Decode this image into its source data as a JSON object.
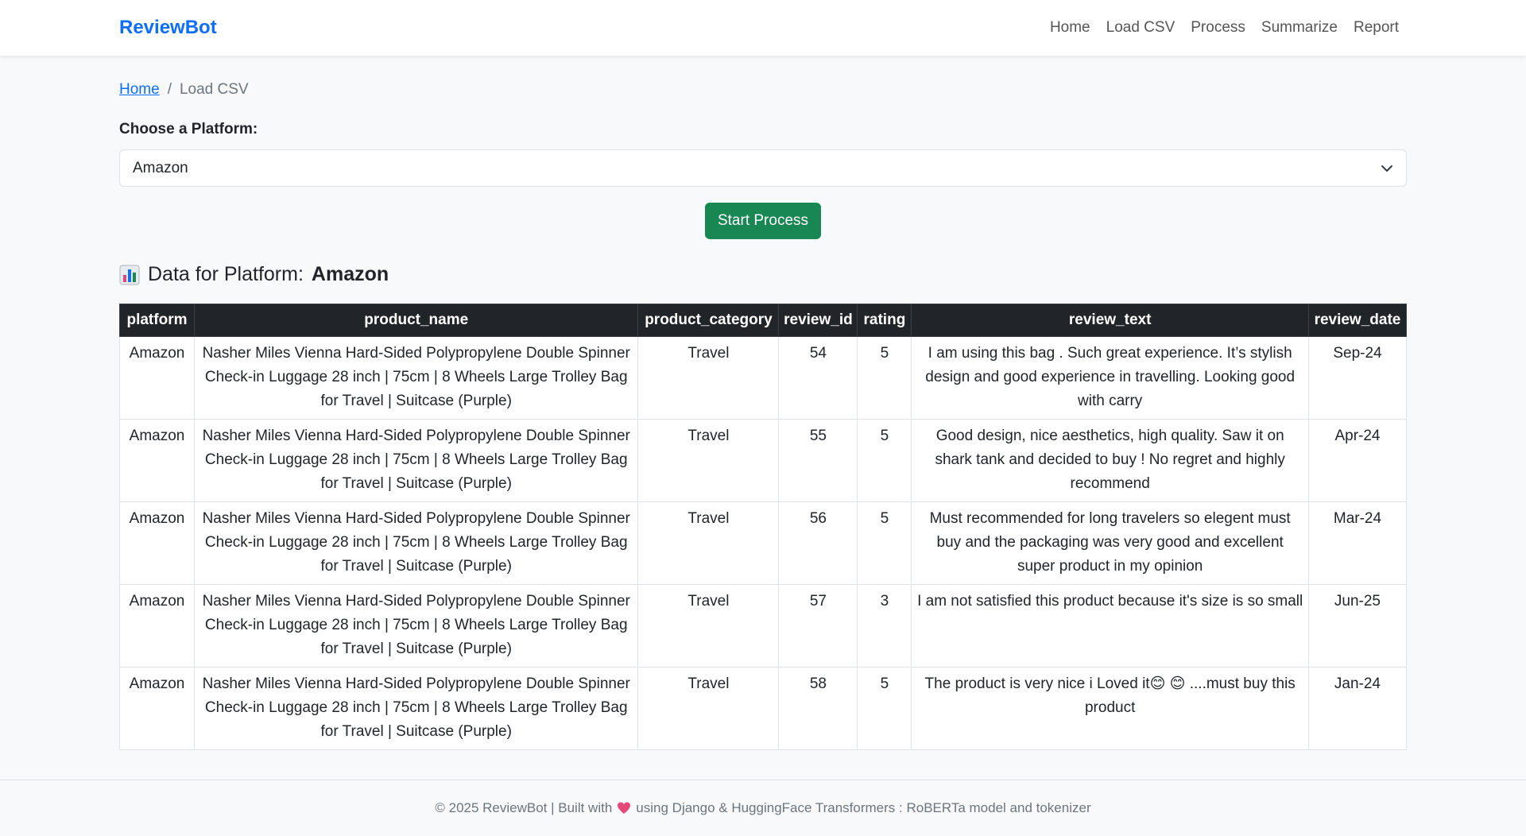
{
  "navbar": {
    "brand": "ReviewBot",
    "links": [
      "Home",
      "Load CSV",
      "Process",
      "Summarize",
      "Report"
    ]
  },
  "breadcrumb": {
    "home": "Home",
    "separator": "/",
    "current": "Load CSV"
  },
  "form": {
    "label": "Choose a Platform:",
    "selected_platform": "Amazon",
    "start_button": "Start Process"
  },
  "data_section": {
    "heading_prefix": "Data for Platform:",
    "platform": "Amazon",
    "columns": [
      "platform",
      "product_name",
      "product_category",
      "review_id",
      "rating",
      "review_text",
      "review_date"
    ],
    "rows": [
      [
        "Amazon",
        "Nasher Miles Vienna Hard-Sided Polypropylene Double Spinner Check-in Luggage 28 inch | 75cm | 8 Wheels Large Trolley Bag for Travel | Suitcase (Purple)",
        "Travel",
        "54",
        "5",
        "I am using this bag . Such great experience. It’s stylish design and good experience in travelling. Looking good with carry",
        "Sep-24"
      ],
      [
        "Amazon",
        "Nasher Miles Vienna Hard-Sided Polypropylene Double Spinner Check-in Luggage 28 inch | 75cm | 8 Wheels Large Trolley Bag for Travel | Suitcase (Purple)",
        "Travel",
        "55",
        "5",
        "Good design, nice aesthetics, high quality. Saw it on shark tank and decided to buy ! No regret and highly recommend",
        "Apr-24"
      ],
      [
        "Amazon",
        "Nasher Miles Vienna Hard-Sided Polypropylene Double Spinner Check-in Luggage 28 inch | 75cm | 8 Wheels Large Trolley Bag for Travel | Suitcase (Purple)",
        "Travel",
        "56",
        "5",
        "Must recommended for long travelers so elegent must buy and the packaging was very good and excellent super product in my opinion",
        "Mar-24"
      ],
      [
        "Amazon",
        "Nasher Miles Vienna Hard-Sided Polypropylene Double Spinner Check-in Luggage 28 inch | 75cm | 8 Wheels Large Trolley Bag for Travel | Suitcase (Purple)",
        "Travel",
        "57",
        "3",
        "I am not satisfied this product because it's size is so small",
        "Jun-25"
      ],
      [
        "Amazon",
        "Nasher Miles Vienna Hard-Sided Polypropylene Double Spinner Check-in Luggage 28 inch | 75cm | 8 Wheels Large Trolley Bag for Travel | Suitcase (Purple)",
        "Travel",
        "58",
        "5",
        "The product is very nice i Loved it😊 😊 ....must buy this product",
        "Jan-24"
      ]
    ]
  },
  "footer": {
    "prefix": "© 2025 ReviewBot | Built with",
    "suffix": "using Django & HuggingFace Transformers : RoBERTa model and tokenizer"
  },
  "icons": {
    "heading_icon": "bar-chart-icon",
    "footer_icon": "heart-icon",
    "select_icon": "chevron-down-icon"
  },
  "colors": {
    "brand": "#0d6efd",
    "start_button": "#198754",
    "table_header": "#212529",
    "heart": "#e8477a"
  }
}
